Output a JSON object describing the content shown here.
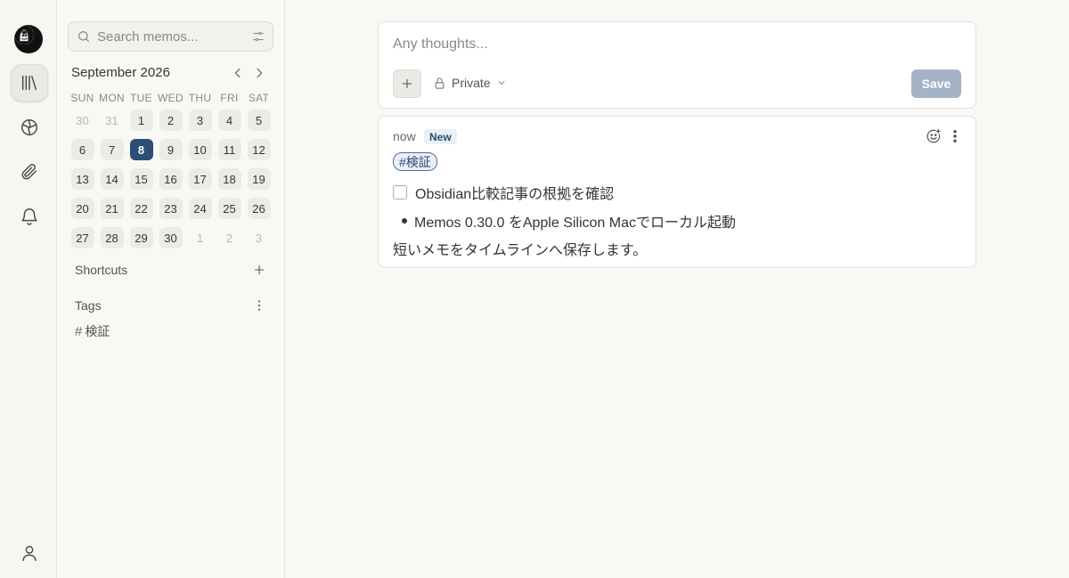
{
  "rail": {
    "icons": [
      "app-logo",
      "library-icon",
      "explore-icon",
      "attachment-icon",
      "bell-icon",
      "user-icon"
    ]
  },
  "search": {
    "placeholder": "Search memos..."
  },
  "calendar": {
    "title": "September 2026",
    "weekdays": [
      "SUN",
      "MON",
      "TUE",
      "WED",
      "THU",
      "FRI",
      "SAT"
    ],
    "weeks": [
      [
        {
          "d": "30",
          "o": true
        },
        {
          "d": "31",
          "o": true
        },
        {
          "d": "1"
        },
        {
          "d": "2"
        },
        {
          "d": "3"
        },
        {
          "d": "4"
        },
        {
          "d": "5"
        }
      ],
      [
        {
          "d": "6"
        },
        {
          "d": "7"
        },
        {
          "d": "8",
          "t": true
        },
        {
          "d": "9"
        },
        {
          "d": "10"
        },
        {
          "d": "11"
        },
        {
          "d": "12"
        }
      ],
      [
        {
          "d": "13"
        },
        {
          "d": "14"
        },
        {
          "d": "15"
        },
        {
          "d": "16"
        },
        {
          "d": "17"
        },
        {
          "d": "18"
        },
        {
          "d": "19"
        }
      ],
      [
        {
          "d": "20"
        },
        {
          "d": "21"
        },
        {
          "d": "22"
        },
        {
          "d": "23"
        },
        {
          "d": "24"
        },
        {
          "d": "25"
        },
        {
          "d": "26"
        }
      ],
      [
        {
          "d": "27"
        },
        {
          "d": "28"
        },
        {
          "d": "29"
        },
        {
          "d": "30"
        },
        {
          "d": "1",
          "o": true
        },
        {
          "d": "2",
          "o": true
        },
        {
          "d": "3",
          "o": true
        }
      ]
    ]
  },
  "sidebar": {
    "shortcuts_label": "Shortcuts",
    "tags_label": "Tags",
    "tags": [
      "検証"
    ]
  },
  "editor": {
    "placeholder": "Any thoughts...",
    "visibility": "Private",
    "save_label": "Save"
  },
  "memo": {
    "time": "now",
    "badge": "New",
    "tag": "#検証",
    "task": "Obsidian比較記事の根拠を確認",
    "bullet": "Memos 0.30.0 をApple Silicon Macでローカル起動",
    "paragraph": "短いメモをタイムラインへ保存します。"
  }
}
